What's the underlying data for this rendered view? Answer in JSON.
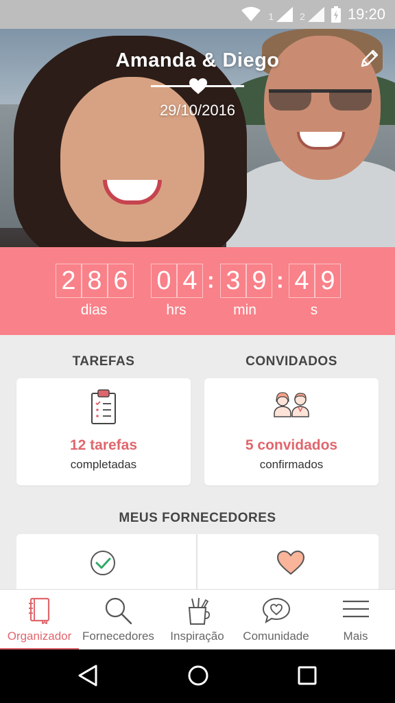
{
  "status": {
    "sim1": "1",
    "sim2": "2",
    "time": "19:20"
  },
  "hero": {
    "names": "Amanda & Diego",
    "date": "29/10/2016"
  },
  "countdown": {
    "days": [
      "2",
      "8",
      "6"
    ],
    "hours": [
      "0",
      "4"
    ],
    "minutes": [
      "3",
      "9"
    ],
    "seconds": [
      "4",
      "9"
    ],
    "colon": ":",
    "labels": {
      "days": "dias",
      "hours": "hrs",
      "minutes": "min",
      "seconds": "s"
    }
  },
  "tasks": {
    "title": "TAREFAS",
    "count": "12 tarefas",
    "sub": "completadas"
  },
  "guests": {
    "title": "CONVIDADOS",
    "count": "5 convidados",
    "sub": "confirmados"
  },
  "vendors": {
    "title": "MEUS FORNECEDORES"
  },
  "nav": [
    {
      "label": "Organizador",
      "icon": "notebook-icon",
      "active": true
    },
    {
      "label": "Fornecedores",
      "icon": "search-icon",
      "active": false
    },
    {
      "label": "Inspiração",
      "icon": "brush-cup-icon",
      "active": false
    },
    {
      "label": "Comunidade",
      "icon": "chat-heart-icon",
      "active": false
    },
    {
      "label": "Mais",
      "icon": "menu-icon",
      "active": false
    }
  ],
  "colors": {
    "accent": "#f98189",
    "accent_text": "#e0666d",
    "background": "#ececec"
  }
}
